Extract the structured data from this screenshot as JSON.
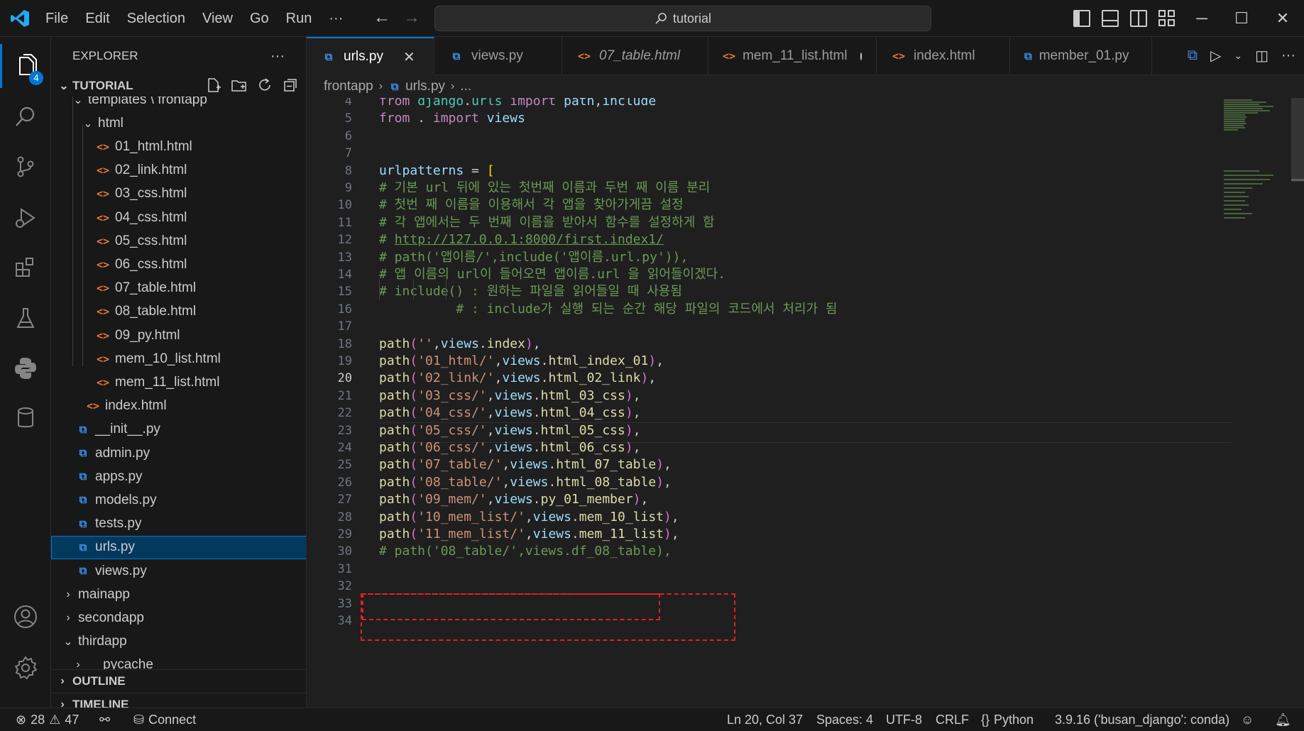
{
  "titlebar": {
    "menu": [
      "File",
      "Edit",
      "Selection",
      "View",
      "Go",
      "Run",
      "···"
    ],
    "search": "tutorial",
    "window_controls": [
      "─",
      "☐",
      "✕"
    ]
  },
  "activity_bar": {
    "explorer_badge": "4",
    "icons": [
      "files-icon",
      "search-icon",
      "source-control-icon",
      "run-debug-icon",
      "extensions-icon",
      "testing-icon",
      "python-icon",
      "database-icon",
      "account-icon",
      "settings-gear-icon"
    ]
  },
  "sidebar": {
    "title": "EXPLORER",
    "more": "···",
    "section": "TUTORIAL",
    "tree": [
      {
        "label": "templates \\ frontapp",
        "type": "folder-open",
        "depth": 1
      },
      {
        "label": "html",
        "type": "folder-open",
        "depth": 2
      },
      {
        "label": "01_html.html",
        "type": "html",
        "depth": 3
      },
      {
        "label": "02_link.html",
        "type": "html",
        "depth": 3
      },
      {
        "label": "03_css.html",
        "type": "html",
        "depth": 3
      },
      {
        "label": "04_css.html",
        "type": "html",
        "depth": 3
      },
      {
        "label": "05_css.html",
        "type": "html",
        "depth": 3
      },
      {
        "label": "06_css.html",
        "type": "html",
        "depth": 3
      },
      {
        "label": "07_table.html",
        "type": "html",
        "depth": 3
      },
      {
        "label": "08_table.html",
        "type": "html",
        "depth": 3
      },
      {
        "label": "09_py.html",
        "type": "html",
        "depth": 3
      },
      {
        "label": "mem_10_list.html",
        "type": "html",
        "depth": 3
      },
      {
        "label": "mem_11_list.html",
        "type": "html",
        "depth": 3
      },
      {
        "label": "index.html",
        "type": "html",
        "depth": 2
      },
      {
        "label": "__init__.py",
        "type": "py",
        "depth": 1
      },
      {
        "label": "admin.py",
        "type": "py",
        "depth": 1
      },
      {
        "label": "apps.py",
        "type": "py",
        "depth": 1
      },
      {
        "label": "models.py",
        "type": "py",
        "depth": 1
      },
      {
        "label": "tests.py",
        "type": "py",
        "depth": 1
      },
      {
        "label": "urls.py",
        "type": "py",
        "depth": 1,
        "selected": true
      },
      {
        "label": "views.py",
        "type": "py",
        "depth": 1
      },
      {
        "label": "mainapp",
        "type": "folder-closed",
        "depth": 0
      },
      {
        "label": "secondapp",
        "type": "folder-closed",
        "depth": 0
      },
      {
        "label": "thirdapp",
        "type": "folder-open",
        "depth": 0
      },
      {
        "label": "__pycache__",
        "type": "folder-closed",
        "depth": 1
      }
    ],
    "outline": "OUTLINE",
    "timeline": "TIMELINE"
  },
  "tabs": [
    {
      "label": "urls.py",
      "type": "py",
      "active": true,
      "close": "✕"
    },
    {
      "label": "views.py",
      "type": "py"
    },
    {
      "label": "07_table.html",
      "type": "html",
      "italic": true
    },
    {
      "label": "mem_11_list.html",
      "type": "html",
      "dirty": true
    },
    {
      "label": "index.html",
      "type": "html"
    },
    {
      "label": "member_01.py",
      "type": "py",
      "dirty": true
    }
  ],
  "breadcrumb": [
    "frontapp",
    "urls.py",
    "..."
  ],
  "editor": {
    "current_line": 20,
    "line_numbers": [
      "4",
      "5",
      "6",
      "7",
      "8",
      "9",
      "10",
      "11",
      "12",
      "13",
      "14",
      "15",
      "16",
      "17",
      "18",
      "19",
      "20",
      "21",
      "22",
      "23",
      "24",
      "25",
      "26",
      "27",
      "28",
      "29",
      "30",
      "31",
      "32",
      "33",
      "34"
    ],
    "lines": [
      [
        [
          "kw",
          "from "
        ],
        [
          "mod",
          "django"
        ],
        [
          "",
          "."
        ],
        [
          "mod",
          "urls "
        ],
        [
          "kw",
          "import "
        ],
        [
          "id",
          "path"
        ],
        [
          "",
          ","
        ],
        [
          "id",
          "include"
        ]
      ],
      [
        [
          "kw",
          "from "
        ],
        [
          "",
          ". "
        ],
        [
          "kw",
          "import "
        ],
        [
          "id",
          "views"
        ]
      ],
      [],
      [],
      [
        [
          "id",
          "urlpatterns "
        ],
        [
          "",
          "= "
        ],
        [
          "br",
          "["
        ]
      ],
      [
        [
          "cm",
          "# 기본 url 뒤에 있는 첫번째 이름과 두번 째 이름 분리"
        ]
      ],
      [
        [
          "cm",
          "# 첫번 째 이름을 이용해서 각 앱을 찾아가게끔 설정"
        ]
      ],
      [
        [
          "cm",
          "# 각 앱에서는 두 번째 이름을 받아서 함수를 설정하게 함"
        ]
      ],
      [
        [
          "cm",
          "# "
        ],
        [
          "cml",
          "http://127.0.0.1:8000/first.index1/"
        ]
      ],
      [
        [
          "cm",
          "# path('앱이름/',include('앱이름.url.py')),"
        ]
      ],
      [
        [
          "cm",
          "# 앱 이름의 url이 들어오면 앱이름.url 을 읽어들이겠다."
        ]
      ],
      [
        [
          "cm",
          "# include() : 원하는 파일을 읽어들일 때 사용됨"
        ]
      ],
      [
        [
          "",
          "          "
        ],
        [
          "cm",
          "# : include가 실행 되는 순간 해당 파일의 코드에서 처리가 됨"
        ]
      ],
      [],
      [
        [
          "fn",
          "path"
        ],
        [
          "br2",
          "("
        ],
        [
          "str",
          "''"
        ],
        [
          "",
          ","
        ],
        [
          "id",
          "views"
        ],
        [
          "",
          "."
        ],
        [
          "fn",
          "index"
        ],
        [
          "br2",
          ")"
        ],
        [
          "",
          ","
        ]
      ],
      [
        [
          "fn",
          "path"
        ],
        [
          "br2",
          "("
        ],
        [
          "str",
          "'01_html/'"
        ],
        [
          "",
          ","
        ],
        [
          "id",
          "views"
        ],
        [
          "",
          "."
        ],
        [
          "fn",
          "html_index_01"
        ],
        [
          "br2",
          ")"
        ],
        [
          "",
          ","
        ]
      ],
      [
        [
          "fn",
          "path"
        ],
        [
          "br2",
          "("
        ],
        [
          "str",
          "'02_link/'"
        ],
        [
          "",
          ","
        ],
        [
          "id",
          "views"
        ],
        [
          "",
          "."
        ],
        [
          "fn",
          "html_02_link"
        ],
        [
          "br2",
          ")"
        ],
        [
          "",
          ","
        ]
      ],
      [
        [
          "fn",
          "path"
        ],
        [
          "br2",
          "("
        ],
        [
          "str",
          "'03_css/'"
        ],
        [
          "",
          ","
        ],
        [
          "id",
          "views"
        ],
        [
          "",
          "."
        ],
        [
          "fn",
          "html_03_css"
        ],
        [
          "br2",
          ")"
        ],
        [
          "",
          ","
        ]
      ],
      [
        [
          "fn",
          "path"
        ],
        [
          "br2",
          "("
        ],
        [
          "str",
          "'04_css/'"
        ],
        [
          "",
          ","
        ],
        [
          "id",
          "views"
        ],
        [
          "",
          "."
        ],
        [
          "fn",
          "html_04_css"
        ],
        [
          "br2",
          ")"
        ],
        [
          "",
          ","
        ]
      ],
      [
        [
          "fn",
          "path"
        ],
        [
          "br2",
          "("
        ],
        [
          "str",
          "'05_css/'"
        ],
        [
          "",
          ","
        ],
        [
          "id",
          "views"
        ],
        [
          "",
          "."
        ],
        [
          "fn",
          "html_05_css"
        ],
        [
          "br2",
          ")"
        ],
        [
          "",
          ","
        ]
      ],
      [
        [
          "fn",
          "path"
        ],
        [
          "br2",
          "("
        ],
        [
          "str",
          "'06_css/'"
        ],
        [
          "",
          ","
        ],
        [
          "id",
          "views"
        ],
        [
          "",
          "."
        ],
        [
          "fn",
          "html_06_css"
        ],
        [
          "br2",
          ")"
        ],
        [
          "",
          ","
        ]
      ],
      [
        [
          "fn",
          "path"
        ],
        [
          "br2",
          "("
        ],
        [
          "str",
          "'07_table/'"
        ],
        [
          "",
          ","
        ],
        [
          "id",
          "views"
        ],
        [
          "",
          "."
        ],
        [
          "fn",
          "html_07_table"
        ],
        [
          "br2",
          ")"
        ],
        [
          "",
          ","
        ]
      ],
      [
        [
          "fn",
          "path"
        ],
        [
          "br2",
          "("
        ],
        [
          "str",
          "'08_table/'"
        ],
        [
          "",
          ","
        ],
        [
          "id",
          "views"
        ],
        [
          "",
          "."
        ],
        [
          "fn",
          "html_08_table"
        ],
        [
          "br2",
          ")"
        ],
        [
          "",
          ","
        ]
      ],
      [
        [
          "fn",
          "path"
        ],
        [
          "br2",
          "("
        ],
        [
          "str",
          "'09_mem/'"
        ],
        [
          "",
          ","
        ],
        [
          "id",
          "views"
        ],
        [
          "",
          "."
        ],
        [
          "fn",
          "py_01_member"
        ],
        [
          "br2",
          ")"
        ],
        [
          "",
          ","
        ]
      ],
      [
        [
          "fn",
          "path"
        ],
        [
          "br2",
          "("
        ],
        [
          "str",
          "'10_mem_list/'"
        ],
        [
          "",
          ","
        ],
        [
          "id",
          "views"
        ],
        [
          "",
          "."
        ],
        [
          "fn",
          "mem_10_list"
        ],
        [
          "br2",
          ")"
        ],
        [
          "",
          ","
        ]
      ],
      [
        [
          "fn",
          "path"
        ],
        [
          "br2",
          "("
        ],
        [
          "str",
          "'11_mem_list/'"
        ],
        [
          "",
          ","
        ],
        [
          "id",
          "views"
        ],
        [
          "",
          "."
        ],
        [
          "fn",
          "mem_11_list"
        ],
        [
          "br2",
          ")"
        ],
        [
          "",
          ","
        ]
      ],
      [
        [
          "cm",
          "# path('08_table/',views.df_08_table),"
        ]
      ],
      [],
      [],
      [],
      []
    ]
  },
  "statusbar": {
    "errors": "28",
    "warnings": "47",
    "connect": "Connect",
    "position": "Ln 20, Col 37",
    "spaces": "Spaces: 4",
    "encoding": "UTF-8",
    "eol": "CRLF",
    "language": "Python",
    "interpreter": "3.9.16 ('busan_django': conda)"
  },
  "colors": {
    "accent": "#0078d4",
    "highlight_box": "#e02020",
    "html_icon": "#e37933",
    "python_icon": "#3b8eea"
  }
}
